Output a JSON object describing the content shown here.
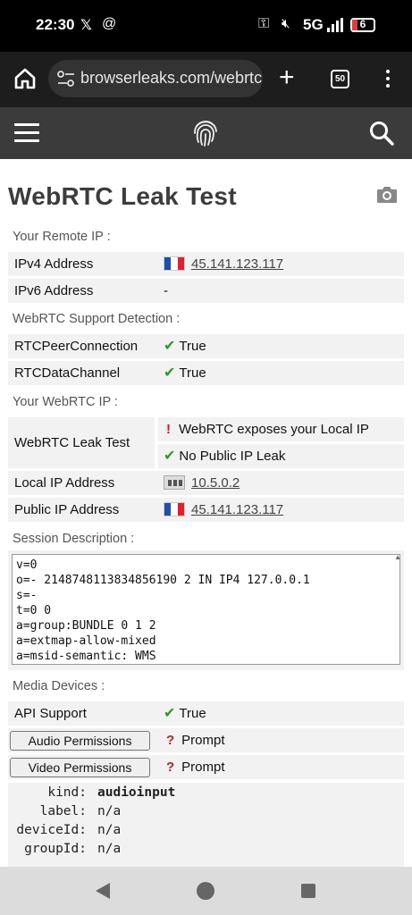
{
  "status_bar": {
    "time": "22:30",
    "network": "5G",
    "battery": "6",
    "x_icon": "x-logo-icon",
    "threads_icon": "threads-icon"
  },
  "browser": {
    "url": "browserleaks.com/webrtc",
    "tab_count": "50"
  },
  "page": {
    "title": "WebRTC Leak Test"
  },
  "remote_ip": {
    "section": "Your Remote IP :",
    "ipv4_label": "IPv4 Address",
    "ipv4_value": "45.141.123.117",
    "ipv6_label": "IPv6 Address",
    "ipv6_value": "-"
  },
  "support": {
    "section": "WebRTC Support Detection :",
    "peer_label": "RTCPeerConnection",
    "peer_value": "True",
    "data_label": "RTCDataChannel",
    "data_value": "True"
  },
  "webrtc_ip": {
    "section": "Your WebRTC IP :",
    "leak_label": "WebRTC Leak Test",
    "leak_warning": "WebRTC exposes your Local IP",
    "leak_public": "No Public IP Leak",
    "local_label": "Local IP Address",
    "local_value": "10.5.0.2",
    "public_label": "Public IP Address",
    "public_value": "45.141.123.117"
  },
  "session": {
    "section": "Session Description :",
    "sdp": "v=0\no=- 2148748113834856190 2 IN IP4 127.0.0.1\ns=-\nt=0 0\na=group:BUNDLE 0 1 2\na=extmap-allow-mixed\na=msid-semantic: WMS"
  },
  "media": {
    "section": "Media Devices :",
    "api_label": "API Support",
    "api_value": "True",
    "audio_button": "Audio Permissions",
    "audio_value": "Prompt",
    "video_button": "Video Permissions",
    "video_value": "Prompt",
    "device": {
      "kind_key": "kind:",
      "kind": "audioinput",
      "label_key": "label:",
      "label": "n/a",
      "deviceId_key": "deviceId:",
      "deviceId": "n/a",
      "groupId_key": "groupId:",
      "groupId": "n/a"
    }
  },
  "colors": {
    "header": "#3b3b3b",
    "browser_bar": "#1d1d1d",
    "check": "#2c9a2c",
    "warning": "#dd1111",
    "row_bg": "#f2f2f2"
  },
  "flag": {
    "country_icon": "france-flag-icon",
    "colors": [
      "#1f4fa8",
      "#ffffff",
      "#e1202c"
    ]
  }
}
